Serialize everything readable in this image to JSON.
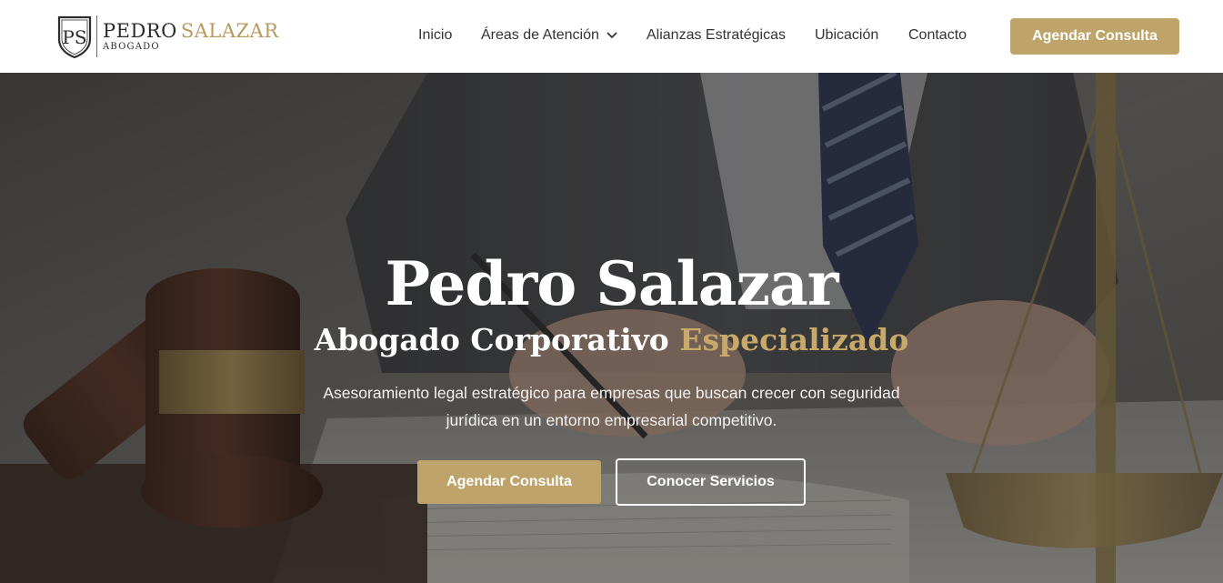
{
  "brand": {
    "monogram": "PS",
    "first_name": "PEDRO",
    "last_name": "SALAZAR",
    "subtitle": "ABOGADO"
  },
  "nav": {
    "items": [
      {
        "label": "Inicio"
      },
      {
        "label": "Áreas de Atención",
        "has_dropdown": true
      },
      {
        "label": "Alianzas Estratégicas"
      },
      {
        "label": "Ubicación"
      },
      {
        "label": "Contacto"
      }
    ],
    "cta_label": "Agendar Consulta"
  },
  "hero": {
    "title": "Pedro Salazar",
    "subtitle_main": "Abogado Corporativo",
    "subtitle_accent": "Especializado",
    "description": "Asesoramiento legal estratégico para empresas que buscan crecer con seguridad jurídica en un entorno empresarial competitivo.",
    "primary_button": "Agendar Consulta",
    "secondary_button": "Conocer Servicios",
    "background_scene": "lawyer-signing-document-with-gavel-and-scales"
  },
  "colors": {
    "accent_gold": "#bea36a",
    "header_bg": "#ffffff",
    "nav_text": "#333333",
    "hero_text": "#ffffff"
  },
  "icons": {
    "dropdown": "chevron-down-icon",
    "logo": "ps-shield-logo-icon"
  }
}
